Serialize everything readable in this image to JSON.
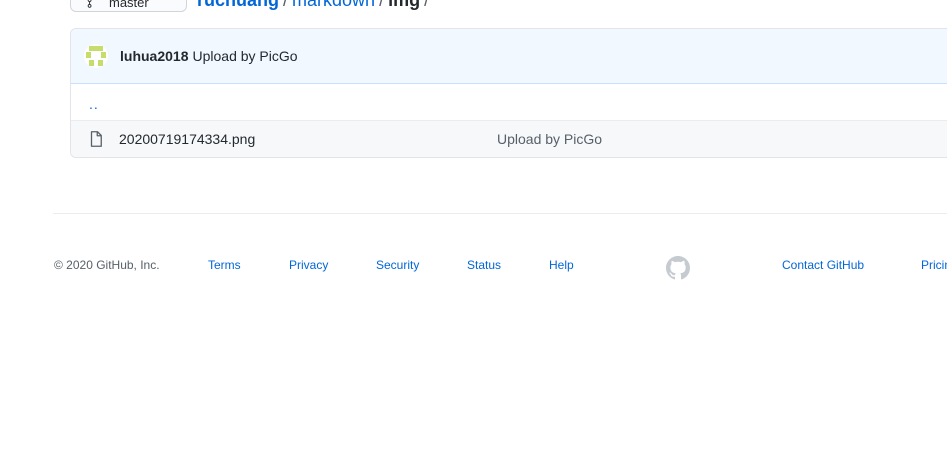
{
  "branch": {
    "label": "master"
  },
  "breadcrumb": {
    "parts": [
      "ruchuang",
      "markdown",
      "img"
    ],
    "separator": "/"
  },
  "commit_bar": {
    "author": "luhua2018",
    "message": "Upload by PicGo"
  },
  "files": {
    "parent_link": "..",
    "rows": [
      {
        "name": "20200719174334.png",
        "commit_message": "Upload by PicGo",
        "icon": "file-icon"
      }
    ]
  },
  "footer": {
    "copyright": "© 2020 GitHub, Inc.",
    "links": {
      "terms": "Terms",
      "privacy": "Privacy",
      "security": "Security",
      "status": "Status",
      "help": "Help",
      "contact": "Contact GitHub",
      "pricing": "Pricing"
    },
    "logo_icon": "github-mark-icon"
  },
  "colors": {
    "link": "#0366d6",
    "commit_bar_bg": "#f1f8ff",
    "commit_bar_border": "#c8e1ff",
    "row_bg": "#f6f8fa",
    "muted_text": "#586069",
    "border": "#e1e4e8",
    "avatar_accent": "#c5dd6a"
  }
}
